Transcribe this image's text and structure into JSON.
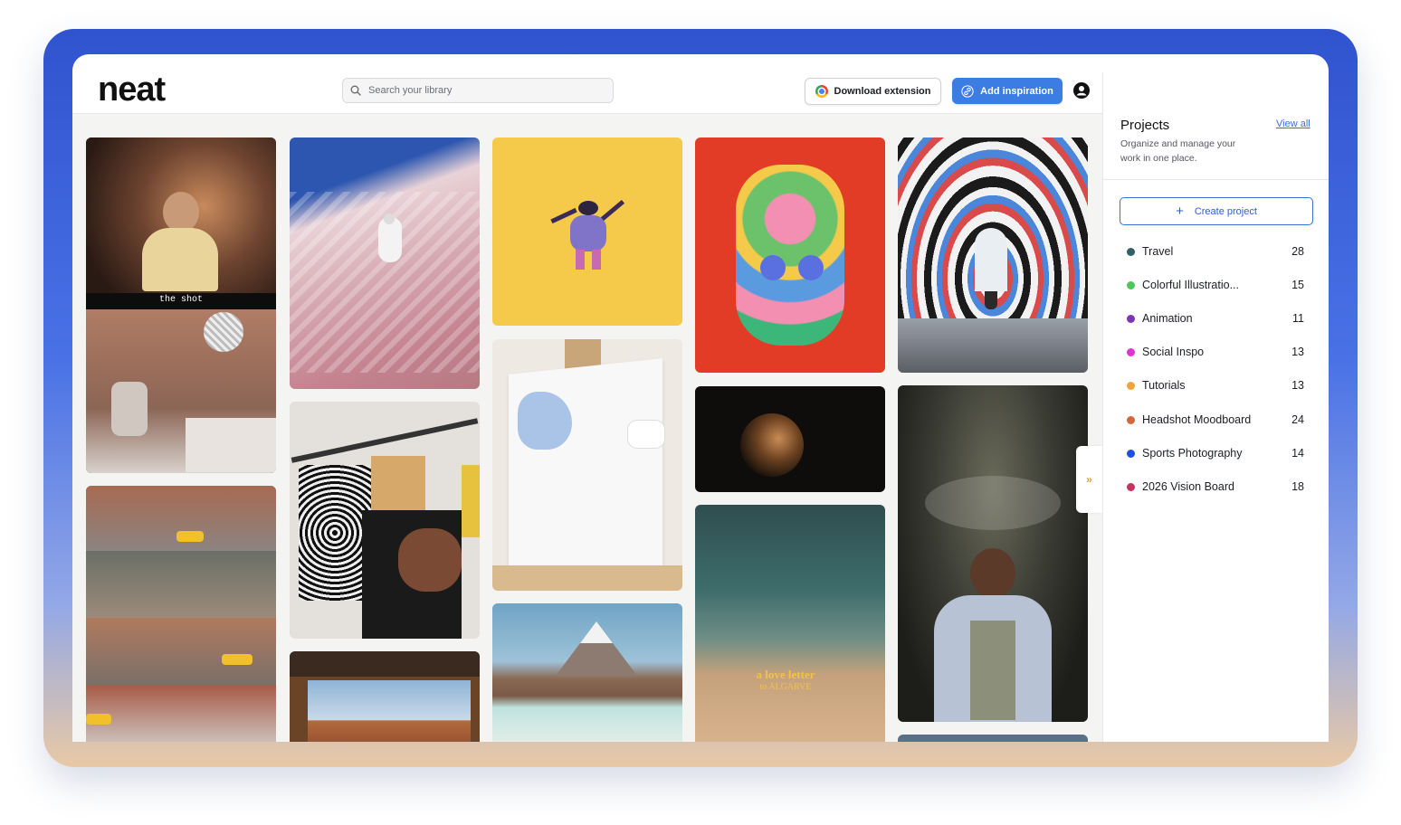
{
  "app": {
    "logo": "neat"
  },
  "header": {
    "search_placeholder": "Search your library",
    "download_extension_label": "Download extension",
    "add_inspiration_label": "Add inspiration"
  },
  "gallery": {
    "tiles": [
      {
        "id": "studio-video",
        "caption": "the shot"
      },
      {
        "id": "painted-ski-slope"
      },
      {
        "id": "jumping-figure-yellow"
      },
      {
        "id": "flower-mask-illustration"
      },
      {
        "id": "striped-arches-corridor"
      },
      {
        "id": "city-street-collage"
      },
      {
        "id": "clothes-rack"
      },
      {
        "id": "painting-canvas"
      },
      {
        "id": "dark-portrait"
      },
      {
        "id": "smoke-performer"
      },
      {
        "id": "desert-window"
      },
      {
        "id": "mountain-lake"
      },
      {
        "id": "beach-letter",
        "title": "a love letter",
        "subtitle": "to ALGARVE"
      }
    ],
    "collapse_icon": "double-chevron-right-icon"
  },
  "sidebar": {
    "title": "Projects",
    "view_all": "View all",
    "subtitle": "Organize and manage your work in one place.",
    "create_label": "Create project",
    "projects": [
      {
        "name": "Travel",
        "count": "28",
        "color": "#2f6166"
      },
      {
        "name": "Colorful Illustratio...",
        "count": "15",
        "color": "#4cc85a"
      },
      {
        "name": "Animation",
        "count": "11",
        "color": "#7a35b8"
      },
      {
        "name": "Social Inspo",
        "count": "13",
        "color": "#e234d6"
      },
      {
        "name": "Tutorials",
        "count": "13",
        "color": "#f0a43a"
      },
      {
        "name": "Headshot Moodboard",
        "count": "24",
        "color": "#d4663a"
      },
      {
        "name": "Sports Photography",
        "count": "14",
        "color": "#1d4fe0"
      },
      {
        "name": "2026 Vision Board",
        "count": "18",
        "color": "#c8325e"
      }
    ]
  }
}
